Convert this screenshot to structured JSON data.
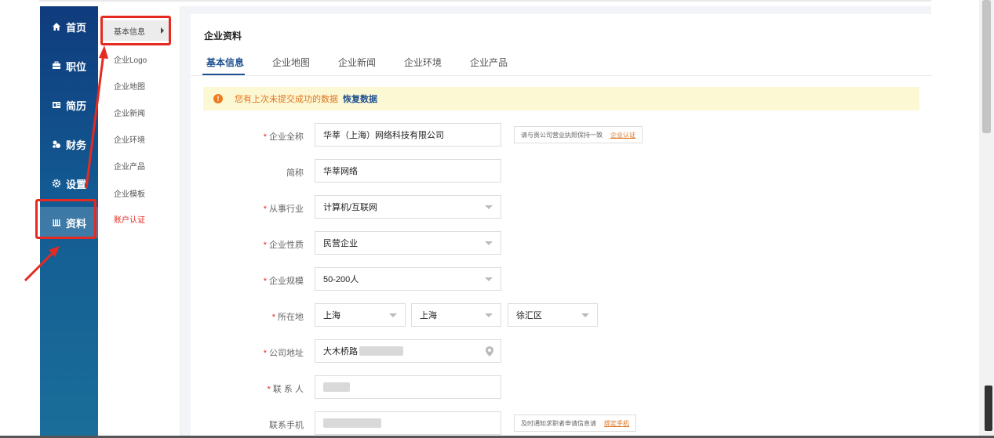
{
  "main_nav": {
    "items": [
      {
        "label": "首页",
        "icon": "home-icon"
      },
      {
        "label": "职位",
        "icon": "briefcase-icon"
      },
      {
        "label": "简历",
        "icon": "resume-icon"
      },
      {
        "label": "财务",
        "icon": "finance-icon"
      },
      {
        "label": "设置",
        "icon": "gear-icon"
      },
      {
        "label": "资料",
        "icon": "profile-icon"
      }
    ],
    "active": "资料"
  },
  "sub_nav": {
    "items": [
      "基本信息",
      "企业Logo",
      "企业地图",
      "企业新闻",
      "企业环境",
      "企业产品",
      "企业模板",
      "账户认证"
    ],
    "active": "基本信息"
  },
  "page": {
    "title": "企业资料",
    "tabs": [
      "基本信息",
      "企业地图",
      "企业新闻",
      "企业环境",
      "企业产品"
    ],
    "active_tab": "基本信息"
  },
  "notice": {
    "message": "您有上次未提交成功的数据",
    "link": "恢复数据"
  },
  "form": {
    "company_name": {
      "label": "企业全称",
      "value": "华莘（上海）网络科技有限公司",
      "tip": "请与贵公司营业执照保持一致",
      "tip_link": "企业认证"
    },
    "short_name": {
      "label": "简称",
      "value": "华莘网络"
    },
    "industry": {
      "label": "从事行业",
      "value": "计算机/互联网"
    },
    "nature": {
      "label": "企业性质",
      "value": "民营企业"
    },
    "scale": {
      "label": "企业规模",
      "value": "50-200人"
    },
    "location": {
      "label": "所在地",
      "province": "上海",
      "city": "上海",
      "district": "徐汇区"
    },
    "address": {
      "label": "公司地址",
      "value": "大木桥路"
    },
    "contact": {
      "label": "联 系 人"
    },
    "mobile": {
      "label": "联系手机",
      "tip": "及时通知求职者申请信息请",
      "tip_link": "绑定手机"
    }
  },
  "colors": {
    "accent": "#1e4f8f",
    "highlight": "#e52a22",
    "warning": "#e07520"
  }
}
